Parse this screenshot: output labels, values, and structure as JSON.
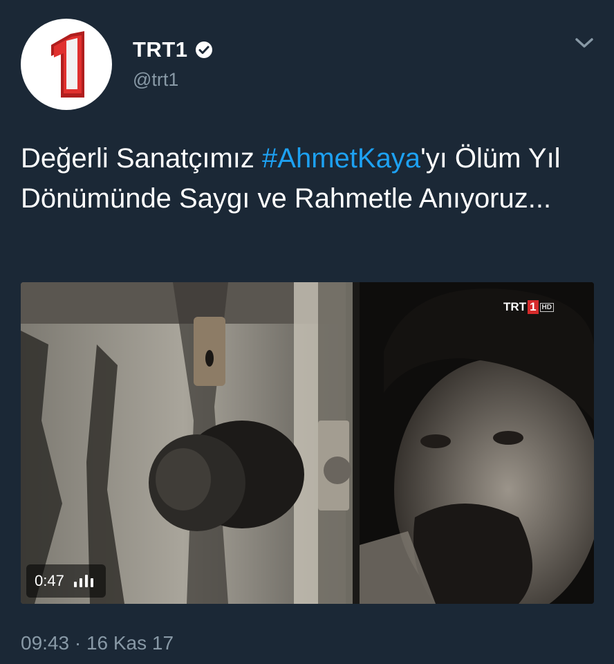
{
  "author": {
    "display_name": "TRT1",
    "handle": "@trt1",
    "avatar_label": "1",
    "verified": true
  },
  "tweet": {
    "text_before": "Değerli Sanatçımız ",
    "hashtag": "#AhmetKaya",
    "text_after": "'yı Ölüm Yıl Dönümünde Saygı ve Rahmetle Anıyoruz...",
    "timestamp": "09:43 · 16 Kas 17"
  },
  "media": {
    "type": "video",
    "duration": "0:47",
    "watermark_brand": "TRT",
    "watermark_number": "1",
    "watermark_hd": "HD"
  },
  "colors": {
    "background": "#1b2836",
    "link": "#1da1f2",
    "secondary_text": "#8899a6",
    "brand_red": "#d52b2b"
  },
  "icons": {
    "verified": "verified-badge-icon",
    "menu": "chevron-down-icon",
    "audio": "audio-bars-icon"
  }
}
